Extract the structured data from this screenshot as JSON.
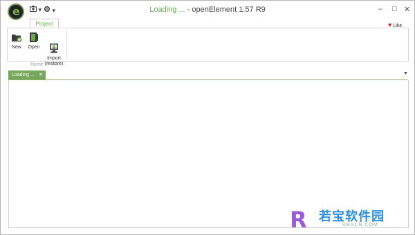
{
  "titlebar": {
    "loading": "Loading ...",
    "title": " - openElement 1.57 R9",
    "minimize": "–",
    "maximize": "□",
    "close": "✕"
  },
  "quick_access": {
    "item1_arrow": "▾",
    "item2_arrow": "▾"
  },
  "ribbon": {
    "tab": "Project",
    "like": "Like",
    "buttons": [
      {
        "label": "New"
      },
      {
        "label": "Open"
      },
      {
        "label": "Import\n(restore)"
      }
    ],
    "group_label": "Home"
  },
  "document_tabs": [
    {
      "label": "Loading ...",
      "close": "✕"
    }
  ],
  "watermark": {
    "main": "若宝软件园",
    "sub": "RBSCN.COM"
  },
  "colors": {
    "accent": "#78a65c",
    "title_loading": "#6aa84f",
    "heart": "#dd2222"
  }
}
